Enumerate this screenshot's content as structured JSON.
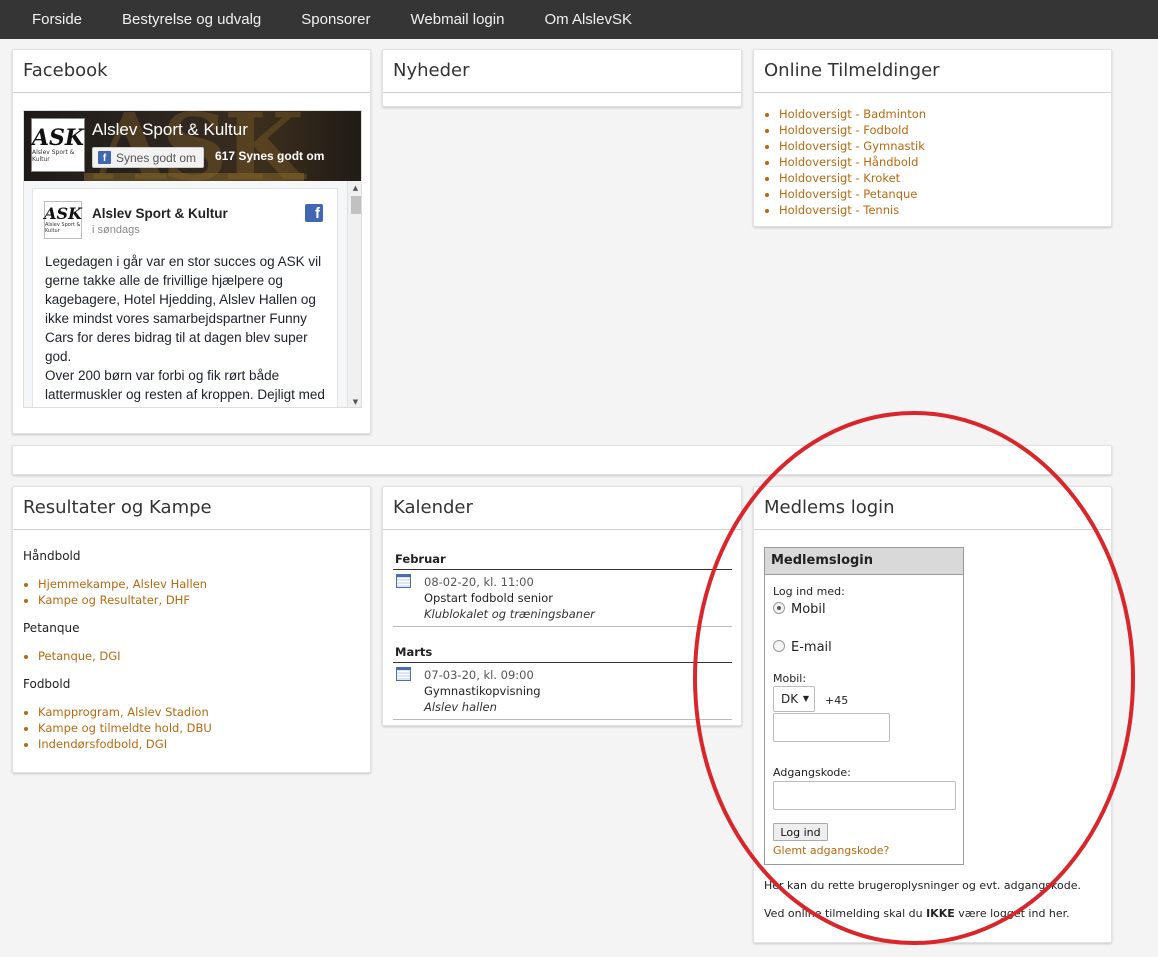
{
  "nav": {
    "items": [
      "Forside",
      "Bestyrelse og udvalg",
      "Sponsorer",
      "Webmail login",
      "Om AlslevSK"
    ]
  },
  "facebook": {
    "title": "Facebook",
    "page_name": "Alslev Sport & Kultur",
    "like_button": "Synes godt om",
    "like_count": "617 Synes godt om",
    "logo_text": "ASK",
    "logo_sub": "Alslev Sport & Kultur",
    "post": {
      "author": "Alslev Sport & Kultur",
      "time": "i søndags",
      "text": "Legedagen i går var en stor succes og ASK vil gerne takke alle de frivillige hjælpere og kagebagere, Hotel Hjedding, Alslev Hallen og ikke mindst vores samarbejdspartner Funny Cars for deres bidrag til at dagen blev super god.\nOver 200 børn var forbi og fik rørt både lattermuskler og resten af kroppen. Dejligt med stor deltagelse"
    }
  },
  "nyheder": {
    "title": "Nyheder"
  },
  "tilmeldinger": {
    "title": "Online Tilmeldinger",
    "items": [
      "Holdoversigt - Badminton",
      "Holdoversigt - Fodbold",
      "Holdoversigt - Gymnastik",
      "Holdoversigt - Håndbold",
      "Holdoversigt - Kroket",
      "Holdoversigt - Petanque",
      "Holdoversigt - Tennis"
    ]
  },
  "resultater": {
    "title": "Resultater og Kampe",
    "groups": [
      {
        "heading": "Håndbold",
        "links": [
          "Hjemmekampe, Alslev Hallen",
          "Kampe og Resultater, DHF"
        ]
      },
      {
        "heading": "Petanque",
        "links": [
          "Petanque, DGI"
        ]
      },
      {
        "heading": "Fodbold",
        "links": [
          "Kampprogram, Alslev Stadion",
          "Kampe og tilmeldte hold, DBU",
          "Indendørsfodbold, DGI"
        ]
      }
    ]
  },
  "kalender": {
    "title": "Kalender",
    "months": [
      {
        "name": "Februar",
        "events": [
          {
            "date": "08-02-20, kl. 11:00",
            "title": "Opstart fodbold senior",
            "place": "Klublokalet og træningsbaner"
          }
        ]
      },
      {
        "name": "Marts",
        "events": [
          {
            "date": "07-03-20, kl. 09:00",
            "title": "Gymnastikopvisning",
            "place": "Alslev hallen"
          }
        ]
      }
    ]
  },
  "login": {
    "title": "Medlems login",
    "box_title": "Medlemslogin",
    "log_ind_med": "Log ind med:",
    "option_mobil": "Mobil",
    "option_email": "E-mail",
    "mobil_label": "Mobil:",
    "country_value": "DK",
    "country_code": "+45",
    "password_label": "Adgangskode:",
    "submit": "Log ind",
    "forgot": "Glemt adgangskode?",
    "info1": "Her kan du rette brugeroplysninger og evt. adgangskode.",
    "info2_prefix": "Ved online tilmelding skal du ",
    "info2_bold": "IKKE",
    "info2_suffix": " være logget ind her."
  },
  "colors": {
    "nav_bg": "#353535",
    "link": "#b8690e",
    "annotation_circle": "#d9262b",
    "facebook_blue": "#4267b2"
  }
}
